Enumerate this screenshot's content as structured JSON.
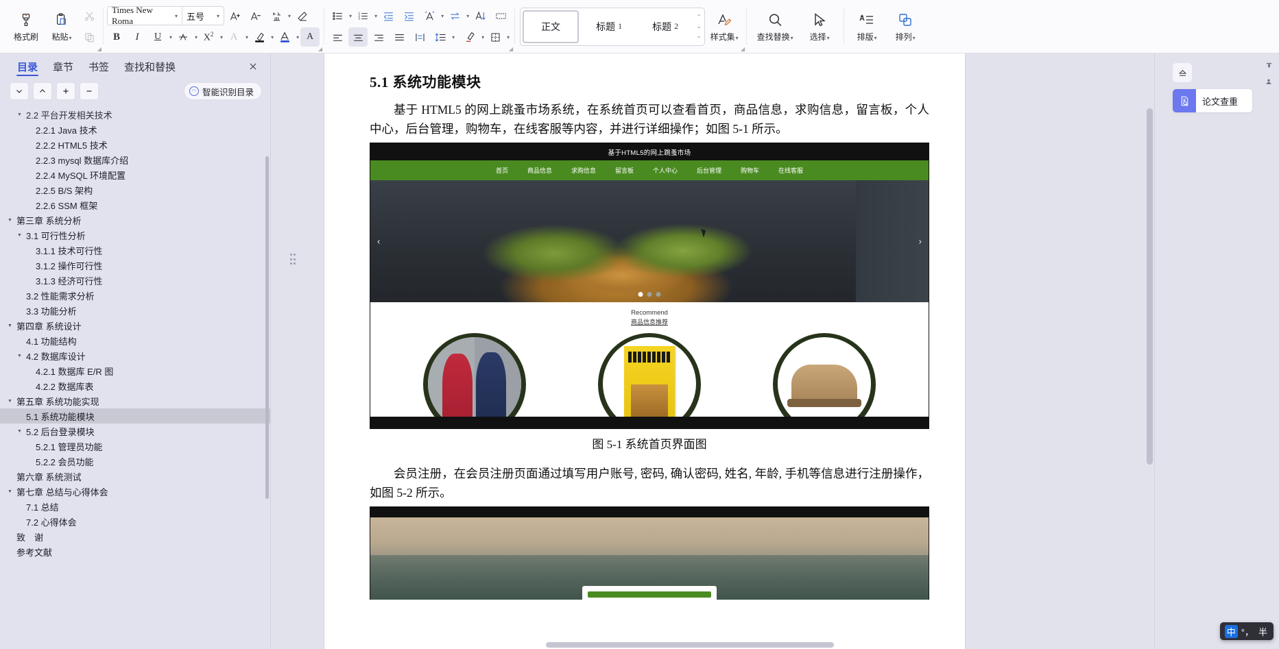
{
  "ribbon": {
    "clipboard": [
      {
        "name": "format-painter",
        "label": "格式刷",
        "icon": "brush-icon"
      },
      {
        "name": "paste",
        "label": "粘贴",
        "icon": "clipboard-icon",
        "caret": true
      }
    ],
    "cut_label": "剪切",
    "copy_label": "复制",
    "font": {
      "family_value": "Times New Roma",
      "size_value": "五号",
      "grow_label": "A+",
      "shrink_label": "A-",
      "pinyin_label": "拼音指南",
      "clear_format_label": "清除格式",
      "bold_label": "B",
      "italic_label": "I",
      "underline_label": "U",
      "strike_label": "删除线",
      "superscript_label": "X²",
      "text_effect_label": "文本效果",
      "highlight_label": "突出显示",
      "font_color_label": "字体颜色",
      "char_shading_label": "字符底纹"
    },
    "paragraph": {
      "bullets_label": "项目符号",
      "numbering_label": "编号",
      "decrease_indent_label": "减少缩进",
      "increase_indent_label": "增加缩进",
      "pinyin_guide_label": "拼音指南",
      "sort_label": "排序",
      "show_marks_label": "显示段落标记",
      "align_left_label": "左对齐",
      "align_center_label": "居中对齐",
      "align_right_label": "右对齐",
      "align_justify_label": "两端对齐",
      "distribute_label": "分散对齐",
      "line_spacing_label": "行距",
      "shading_label": "底纹",
      "borders_label": "边框"
    },
    "styles": {
      "items": [
        {
          "label": "正文",
          "num": "",
          "selected": true
        },
        {
          "label": "标题",
          "num": "1",
          "selected": false
        },
        {
          "label": "标题",
          "num": "2",
          "selected": false
        }
      ],
      "style_set_label": "样式集"
    },
    "tools": [
      {
        "name": "find-replace",
        "label": "查找替换",
        "icon": "search-icon",
        "caret": true
      },
      {
        "name": "select",
        "label": "选择",
        "icon": "cursor-icon",
        "caret": true
      },
      {
        "name": "typeset",
        "label": "排版",
        "icon": "typeset-icon",
        "caret": true
      },
      {
        "name": "arrange",
        "label": "排列",
        "icon": "arrange-icon",
        "caret": true
      }
    ]
  },
  "sidebar": {
    "tabs": [
      {
        "label": "目录",
        "active": true
      },
      {
        "label": "章节",
        "active": false
      },
      {
        "label": "书签",
        "active": false
      },
      {
        "label": "查找和替换",
        "active": false
      }
    ],
    "close_label": "✕",
    "tools": [
      {
        "name": "expand-down",
        "glyph": "⌄"
      },
      {
        "name": "collapse-up",
        "glyph": "⌃"
      },
      {
        "name": "increase-level",
        "glyph": "＋"
      },
      {
        "name": "decrease-level",
        "glyph": "－"
      }
    ],
    "smart_toc_label": "智能识别目录",
    "toc": [
      {
        "label": "2.2  平台开发相关技术",
        "indent": 1,
        "arrow": true,
        "selected": false,
        "clipped": true
      },
      {
        "label": "2.2.1   Java 技术",
        "indent": 2,
        "arrow": false,
        "selected": false
      },
      {
        "label": "2.2.2    HTML5 技术",
        "indent": 2,
        "arrow": false,
        "selected": false
      },
      {
        "label": "2.2.3   mysql 数据库介绍",
        "indent": 2,
        "arrow": false,
        "selected": false
      },
      {
        "label": "2.2.4   MySQL 环境配置",
        "indent": 2,
        "arrow": false,
        "selected": false
      },
      {
        "label": "2.2.5   B/S 架构",
        "indent": 2,
        "arrow": false,
        "selected": false
      },
      {
        "label": "2.2.6   SSM 框架",
        "indent": 2,
        "arrow": false,
        "selected": false
      },
      {
        "label": "第三章 系统分析",
        "indent": 0,
        "arrow": true,
        "selected": false
      },
      {
        "label": "3.1  可行性分析",
        "indent": 1,
        "arrow": true,
        "selected": false
      },
      {
        "label": "3.1.1 技术可行性",
        "indent": 2,
        "arrow": false,
        "selected": false
      },
      {
        "label": "3.1.2 操作可行性",
        "indent": 2,
        "arrow": false,
        "selected": false
      },
      {
        "label": "3.1.3  经济可行性",
        "indent": 2,
        "arrow": false,
        "selected": false
      },
      {
        "label": "3.2 性能需求分析",
        "indent": 1,
        "arrow": false,
        "selected": false
      },
      {
        "label": "3.3 功能分析",
        "indent": 1,
        "arrow": false,
        "selected": false
      },
      {
        "label": "第四章 系统设计",
        "indent": 0,
        "arrow": true,
        "selected": false
      },
      {
        "label": "4.1 功能结构",
        "indent": 1,
        "arrow": false,
        "selected": false
      },
      {
        "label": "4.2  数据库设计",
        "indent": 1,
        "arrow": true,
        "selected": false
      },
      {
        "label": "4.2.1  数据库 E/R 图",
        "indent": 2,
        "arrow": false,
        "selected": false
      },
      {
        "label": "4.2.2  数据库表",
        "indent": 2,
        "arrow": false,
        "selected": false
      },
      {
        "label": "第五章 系统功能实现",
        "indent": 0,
        "arrow": true,
        "selected": false
      },
      {
        "label": "5.1 系统功能模块",
        "indent": 1,
        "arrow": false,
        "selected": true
      },
      {
        "label": "5.2 后台登录模块",
        "indent": 1,
        "arrow": true,
        "selected": false
      },
      {
        "label": "5.2.1 管理员功能",
        "indent": 2,
        "arrow": false,
        "selected": false
      },
      {
        "label": "5.2.2 会员功能",
        "indent": 2,
        "arrow": false,
        "selected": false
      },
      {
        "label": "第六章 系统测试",
        "indent": 0,
        "arrow": false,
        "selected": false
      },
      {
        "label": "第七章 总结与心得体会",
        "indent": 0,
        "arrow": true,
        "selected": false
      },
      {
        "label": "7.1  总结",
        "indent": 1,
        "arrow": false,
        "selected": false
      },
      {
        "label": "7.2  心得体会",
        "indent": 1,
        "arrow": false,
        "selected": false
      },
      {
        "label": "致　谢",
        "indent": 0,
        "arrow": false,
        "selected": false
      },
      {
        "label": "参考文献",
        "indent": 0,
        "arrow": false,
        "selected": false
      }
    ]
  },
  "document": {
    "heading": "5.1 系统功能模块",
    "paragraph1": "基于 HTML5 的网上跳蚤市场系统，在系统首页可以查看首页，商品信息，求购信息，留言板，个人中心，后台管理，购物车，在线客服等内容，并进行详细操作；如图 5-1 所示。",
    "figure1": {
      "site_title": "基于HTML5的网上跳蚤市场",
      "nav": [
        "首页",
        "商品信息",
        "求购信息",
        "留言板",
        "个人中心",
        "后台管理",
        "购物车",
        "在线客服"
      ],
      "prev_arrow": "‹",
      "next_arrow": "›",
      "recommend_en": "Recommend",
      "recommend_cn": "商品信息推荐",
      "carousel_dots": 3,
      "carousel_active": 1
    },
    "caption1": "图 5-1 系统首页界面图",
    "paragraph2": "会员注册，在会员注册页面通过填写用户账号, 密码, 确认密码, 姓名, 年龄, 手机等信息进行注册操作，如图 5-2 所示。"
  },
  "right_panel": {
    "eject_label": "收起",
    "plagiarism_label": "论文查重",
    "plagiarism_icon": "document-search-icon"
  },
  "ime": {
    "mode_label": "中",
    "punct_label": "°，",
    "width_label": "半"
  }
}
